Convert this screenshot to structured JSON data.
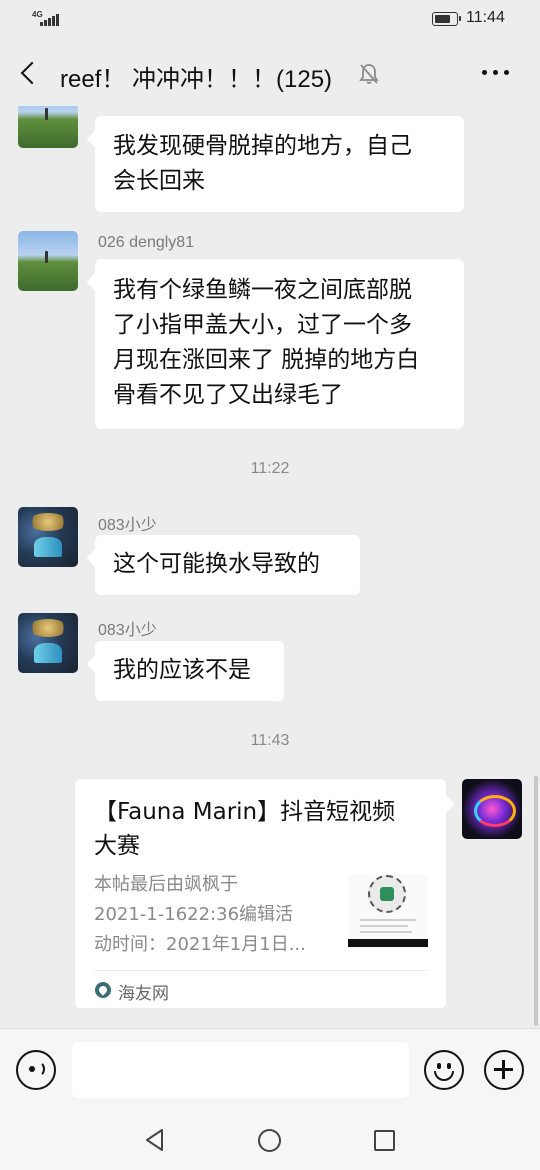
{
  "status_bar": {
    "network": "4G",
    "battery_level": 0.8,
    "time": "11:44"
  },
  "header": {
    "title": "reef！ 冲冲冲！！！(125)",
    "icons": [
      "back-chevron-icon",
      "mute-bell-icon",
      "more-dots-icon"
    ]
  },
  "messages": [
    {
      "type": "text",
      "sender": "",
      "text_lines": [
        "我发现硬骨脱掉的地方，自己",
        "会长回来"
      ],
      "avatar": "landscape"
    },
    {
      "type": "text",
      "sender": "026 dengly81",
      "text_lines": [
        "我有个绿鱼鳞一夜之间底部脱",
        "了小指甲盖大小，过了一个多",
        "月现在涨回来了 脱掉的地方白",
        "骨看不见了又出绿毛了"
      ],
      "avatar": "landscape"
    },
    {
      "type": "timestamp",
      "text": "11:22"
    },
    {
      "type": "text",
      "sender": "083小少",
      "text_lines": [
        "这个可能换水导致的"
      ],
      "avatar": "fish"
    },
    {
      "type": "text",
      "sender": "083小少",
      "text_lines": [
        "我的应该不是"
      ],
      "avatar": "fish"
    },
    {
      "type": "timestamp",
      "text": "11:43"
    },
    {
      "type": "link_card",
      "title_lines": [
        "【Fauna Marin】抖音短视频",
        "大赛"
      ],
      "desc_lines": [
        "本帖最后由飒枫于",
        "2021-1-1622:36编辑活",
        "动时间：2021年1月1日..."
      ],
      "source": "海友网",
      "avatar": "own-mandarin-fish"
    }
  ],
  "input_bar": {
    "placeholder": "",
    "icons": [
      "voice-icon",
      "emoji-icon",
      "plus-icon"
    ]
  },
  "nav_bar": {
    "icons": [
      "nav-back-icon",
      "nav-home-icon",
      "nav-recent-icon"
    ]
  }
}
